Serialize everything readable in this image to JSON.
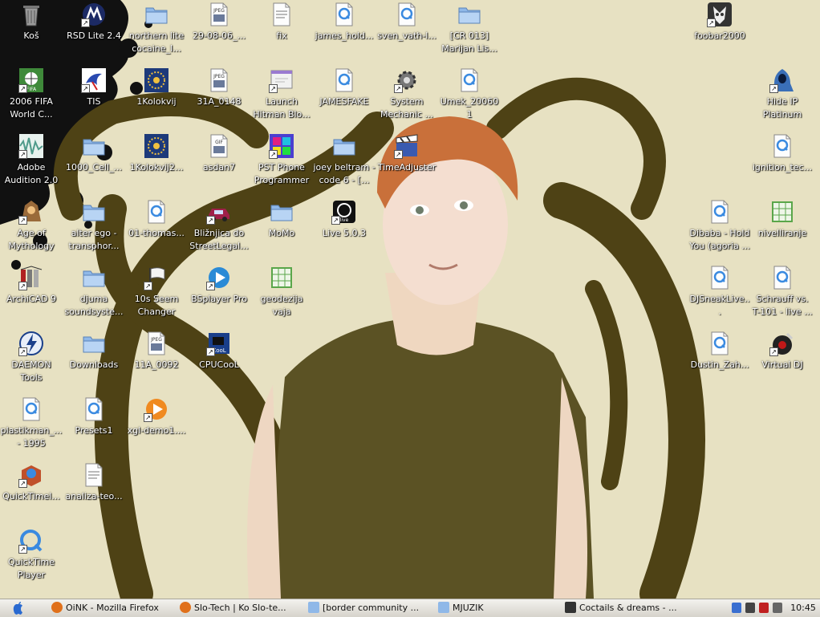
{
  "desktop": {
    "icons": [
      {
        "id": "kos",
        "label": "Koš",
        "icon": "trash-icon",
        "color": "#8a8a8a"
      },
      {
        "id": "rsd-lite",
        "label": "RSD Lite 2.4",
        "icon": "motorola-icon",
        "color": "#1c2a64"
      },
      {
        "id": "northern-lite",
        "label": "northern lite cocaine_I...",
        "icon": "folder-icon",
        "color": "#8fb8e8"
      },
      {
        "id": "jpeg-29",
        "label": "29-08-06_...",
        "icon": "jpeg-file-icon",
        "color": "#c9ccd4"
      },
      {
        "id": "fix",
        "label": "fix",
        "icon": "registry-file-icon",
        "color": "#3b6fd0"
      },
      {
        "id": "james-hold",
        "label": "james_hold...",
        "icon": "quicktime-file-icon",
        "color": "#e6ecf4"
      },
      {
        "id": "sven-vath",
        "label": "sven_vath-l...",
        "icon": "quicktime-file-icon",
        "color": "#e6ecf4"
      },
      {
        "id": "cr013",
        "label": "[CR 013] Marijan Lis...",
        "icon": "folder-icon",
        "color": "#8fb8e8"
      },
      {
        "id": "foobar",
        "label": "foobar2000",
        "icon": "foobar-icon",
        "color": "#333333"
      },
      {
        "id": "fifa",
        "label": "2006 FIFA World C...",
        "icon": "fifa-icon",
        "color": "#3f8a3a"
      },
      {
        "id": "tis",
        "label": "TIS",
        "icon": "bird-icon",
        "color": "#ffffff"
      },
      {
        "id": "kolokvij1",
        "label": "1Kolokvij",
        "icon": "autocad-dwg-icon",
        "color": "#1d3a7a"
      },
      {
        "id": "jpeg-31a",
        "label": "31A_0148",
        "icon": "jpeg-file-icon",
        "color": "#c9ccd4"
      },
      {
        "id": "hitman",
        "label": "Launch Hitman Blo...",
        "icon": "launcher-icon",
        "color": "#f1f1f1"
      },
      {
        "id": "jamesfake",
        "label": "JAMESFAKE",
        "icon": "quicktime-file-icon",
        "color": "#e6ecf4"
      },
      {
        "id": "system-mechanic",
        "label": "System Mechanic ...",
        "icon": "gear-icon",
        "color": "#777777"
      },
      {
        "id": "umek",
        "label": "Umek_20060 1",
        "icon": "quicktime-file-icon",
        "color": "#e6ecf4"
      },
      {
        "id": "hide-ip",
        "label": "Hide IP Platinum",
        "icon": "hooded-figure-icon",
        "color": "#3a6fb8"
      },
      {
        "id": "adobe-audition",
        "label": "Adobe Audition 2.0",
        "icon": "waveform-icon",
        "color": "#4f9a8a"
      },
      {
        "id": "cell-1000",
        "label": "1000_Cell_...",
        "icon": "folder-icon",
        "color": "#8fb8e8"
      },
      {
        "id": "kolokvij2",
        "label": "1Kolokvij2...",
        "icon": "autocad-dwg-icon",
        "color": "#1d3a7a"
      },
      {
        "id": "asdan7",
        "label": "asdan7",
        "icon": "gif-file-icon",
        "color": "#c9ccd4"
      },
      {
        "id": "pst-phone",
        "label": "PST Phone Programmer",
        "icon": "grid-app-icon",
        "color": "#4a3fd0"
      },
      {
        "id": "joey-beltram",
        "label": "joey beltram - code 6 - [...",
        "icon": "folder-icon",
        "color": "#8fb8e8"
      },
      {
        "id": "timeadjuster",
        "label": "TimeAdjuster",
        "icon": "clapper-icon",
        "color": "#3a5ab0"
      },
      {
        "id": "ignition",
        "label": "ignition_tec...",
        "icon": "quicktime-file-icon",
        "color": "#e6ecf4"
      },
      {
        "id": "age-mythology",
        "label": "Age of Mythology",
        "icon": "mythology-icon",
        "color": "#9a6a3a"
      },
      {
        "id": "alter-ego",
        "label": "alter ego - transphor...",
        "icon": "folder-icon",
        "color": "#8fb8e8"
      },
      {
        "id": "thomas",
        "label": "01-thomas...",
        "icon": "quicktime-file-icon",
        "color": "#e6ecf4"
      },
      {
        "id": "bliznjica",
        "label": "Bližnjica do StreetLegal...",
        "icon": "car-icon",
        "color": "#a0204a"
      },
      {
        "id": "momo",
        "label": "MoMo",
        "icon": "folder-icon",
        "color": "#8fb8e8"
      },
      {
        "id": "live",
        "label": "Live 5.0.3",
        "icon": "ableton-live-icon",
        "color": "#111111"
      },
      {
        "id": "dibaba",
        "label": "Dibaba - Hold You (agoria ...",
        "icon": "quicktime-file-icon",
        "color": "#e6ecf4"
      },
      {
        "id": "nivelliranje",
        "label": "nivelliranje",
        "icon": "spreadsheet-icon",
        "color": "#5aa64a"
      },
      {
        "id": "archicad",
        "label": "ArchiCAD 9",
        "icon": "archicad-icon",
        "color": "#7a7a7a"
      },
      {
        "id": "djuma",
        "label": "djuma soundsyste...",
        "icon": "folder-icon",
        "color": "#8fb8e8"
      },
      {
        "id": "seem-changer",
        "label": "10s Seem Changer",
        "icon": "flag-icon",
        "color": "#f5f5f5"
      },
      {
        "id": "bsplayer",
        "label": "BSplayer Pro",
        "icon": "bsplayer-icon",
        "color": "#2a8ad6"
      },
      {
        "id": "geodezija",
        "label": "geodezija vaja",
        "icon": "spreadsheet-icon",
        "color": "#5aa64a"
      },
      {
        "id": "djsneak",
        "label": "DJSneakLive...",
        "icon": "quicktime-file-icon",
        "color": "#e6ecf4"
      },
      {
        "id": "schrauff",
        "label": "Schrauff vs. T-101 - live ...",
        "icon": "quicktime-file-icon",
        "color": "#e6ecf4"
      },
      {
        "id": "daemon",
        "label": "DAEMON Tools",
        "icon": "lightning-icon",
        "color": "#1a3f8a"
      },
      {
        "id": "downloads",
        "label": "Downloads",
        "icon": "folder-icon",
        "color": "#8fb8e8"
      },
      {
        "id": "jpeg-11a",
        "label": "11A_0092",
        "icon": "jpeg-file-icon",
        "color": "#c9ccd4"
      },
      {
        "id": "cpucool",
        "label": "CPUCooL",
        "icon": "chip-icon",
        "color": "#1a3f8a"
      },
      {
        "id": "dustin",
        "label": "Dustin_Zah...",
        "icon": "quicktime-file-icon",
        "color": "#e6ecf4"
      },
      {
        "id": "virtual-dj",
        "label": "Virtual DJ",
        "icon": "turntable-icon",
        "color": "#c01818"
      },
      {
        "id": "plastikman",
        "label": "plastikman_... - 1995",
        "icon": "quicktime-file-icon",
        "color": "#e6ecf4"
      },
      {
        "id": "presets1",
        "label": "Presets1",
        "icon": "quicktime-file-icon",
        "color": "#e6ecf4"
      },
      {
        "id": "xgl-demo",
        "label": "xgl-demo1....",
        "icon": "media-player-icon",
        "color": "#f08a20"
      },
      {
        "id": "quicktimel",
        "label": "QuickTimel...",
        "icon": "package-icon",
        "color": "#c0502a"
      },
      {
        "id": "analiza",
        "label": "analiza-teo...",
        "icon": "document-icon",
        "color": "#dcdcdc"
      },
      {
        "id": "quicktime-player",
        "label": "QuickTime Player",
        "icon": "quicktime-icon",
        "color": "#3a8ae0"
      }
    ]
  },
  "taskbar": {
    "start_icon": "apple-icon",
    "tasks": [
      {
        "label": "OiNK - Mozilla Firefox",
        "icon": "firefox-icon",
        "color": "#e0701a"
      },
      {
        "label": "Slo-Tech | Ko Slo-te...",
        "icon": "firefox-icon",
        "color": "#e0701a"
      },
      {
        "label": "[border community ...",
        "icon": "folder-icon",
        "color": "#8fb8e8"
      },
      {
        "label": "MJUZIK",
        "icon": "folder-icon",
        "color": "#8fb8e8"
      },
      {
        "label": "Coctails & dreams - ...",
        "icon": "terminal-icon",
        "color": "#333333"
      }
    ],
    "tray": [
      {
        "icon": "network-icon",
        "color": "#3a6fd0"
      },
      {
        "icon": "antivirus-icon",
        "color": "#444444"
      },
      {
        "icon": "monitor-icon",
        "color": "#c02020"
      },
      {
        "icon": "volume-icon",
        "color": "#666666"
      }
    ],
    "clock": "10:45"
  }
}
